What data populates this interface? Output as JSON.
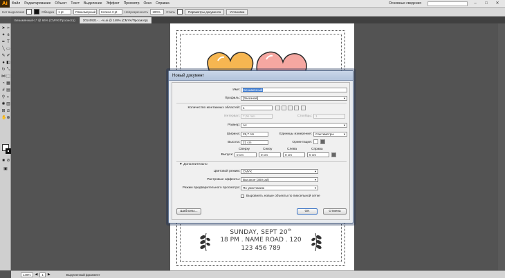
{
  "app": {
    "logo": "Ai"
  },
  "menu": [
    "Файл",
    "Редактирование",
    "Объект",
    "Текст",
    "Выделение",
    "Эффект",
    "Просмотр",
    "Окно",
    "Справка"
  ],
  "workspace": "Основные сведения",
  "controlbar": {
    "selection_label": "Нет выделения",
    "stroke_label": "Обводка",
    "stroke_value": "1 pt",
    "profile_value": "Равномерный",
    "brush_value": "Клякса 3 pt",
    "opacity_label": "Непрозрачность",
    "opacity_value": "100%",
    "style_label": "Стиль",
    "doc_setup_btn": "Параметры документа",
    "prefs_btn": "Установки"
  },
  "tabs": [
    {
      "label": "Безымянный-1* @ 66% (CMYK/Просмотр)"
    },
    {
      "label": "20140921-…-Ai.ai @ 149% (CMYK/Просмотр)",
      "active": true
    }
  ],
  "dialog": {
    "title": "Новый документ",
    "name_label": "Имя:",
    "name_value": "Безымянный",
    "profile_label": "Профиль:",
    "profile_value": "[Заказной]",
    "artboards_label": "Количество монтажных областей:",
    "artboards_value": "1",
    "interval_label": "Интервал:",
    "interval_value": "7,06 mm",
    "columns_label": "Столбцы:",
    "columns_value": "1",
    "size_label": "Размер:",
    "size_value": "A4",
    "width_label": "Ширина:",
    "width_value": "29,7 cm",
    "units_label": "Единицы измерения:",
    "units_value": "Сантиметры",
    "height_label": "Высота:",
    "height_value": "21 cm",
    "orientation_label": "Ориентация:",
    "bleed_label": "Выпуск:",
    "bleed_top_label": "Сверху",
    "bleed_bottom_label": "Снизу",
    "bleed_left_label": "Слева",
    "bleed_right_label": "Справа",
    "bleed_top": "0 cm",
    "bleed_bottom": "0 cm",
    "bleed_left": "0 cm",
    "bleed_right": "0 cm",
    "advanced_label": "Дополнительно",
    "color_mode_label": "Цветовой режим:",
    "color_mode_value": "CMYK",
    "raster_label": "Растровые эффекты:",
    "raster_value": "Высокое (300 ppi)",
    "preview_label": "Режим предварительного просмотра:",
    "preview_value": "По умолчанию",
    "pixel_grid_label": "Выровнять новые объекты по пиксельной сетке",
    "templates_btn": "Шаблоны...",
    "ok_btn": "OK",
    "cancel_btn": "Отмена"
  },
  "poster": {
    "line1": "SUNDAY, SEPT 20",
    "line1_sup": "th",
    "line2": "18 PM . NAME ROAD . 120",
    "line3": "123 456 789"
  },
  "status": {
    "zoom": "149%",
    "page": "1",
    "tool": "Выделенный фрагмент"
  },
  "colors": {
    "heart_orange": "#f6b651",
    "heart_pink": "#f5a7a1",
    "dialog_title": "#b9c8de"
  }
}
